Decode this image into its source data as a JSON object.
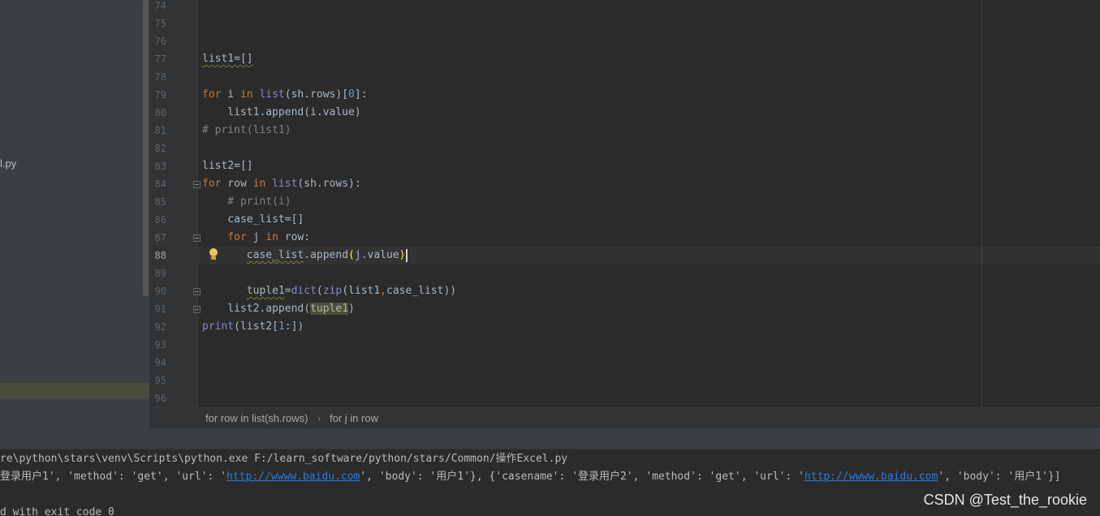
{
  "project": {
    "file_label": "l.py"
  },
  "line_numbers": [
    "74",
    "75",
    "76",
    "77",
    "78",
    "79",
    "80",
    "81",
    "82",
    "83",
    "84",
    "85",
    "86",
    "87",
    "88",
    "89",
    "90",
    "91",
    "92",
    "93",
    "94",
    "95",
    "96"
  ],
  "code": {
    "l77": "list1=[]",
    "l79": {
      "kw1": "for",
      "v1": " i ",
      "kw2": "in",
      "sp": " ",
      "fn": "list",
      "a": "(sh.rows)[",
      "n": "0",
      "b": "]:"
    },
    "l80": "    list1.append(i.value)",
    "l81": "# print(list1)",
    "l83": "list2=[]",
    "l84": {
      "kw1": "for",
      "v1": " row ",
      "kw2": "in",
      "sp": " ",
      "fn": "list",
      "a": "(sh.rows):"
    },
    "l85": "    # print(i)",
    "l86": "    case_list=[]",
    "l87": {
      "ind": "    ",
      "kw1": "for",
      "v1": " j ",
      "kw2": "in",
      "a": " row:"
    },
    "l88": {
      "ind": "       ",
      "a": "case_list",
      "b": ".append",
      "p1": "(",
      "c": "j.value",
      "p2": ")"
    },
    "l90": {
      "ind": "       ",
      "a": "tuple1",
      "b": "=",
      "f1": "dict",
      "c": "(",
      "f2": "zip",
      "d": "(list1",
      "e": ",",
      "g": "case_list))"
    },
    "l91": {
      "ind": "    ",
      "a": "list2.append(",
      "b": "tuple1",
      "c": ")"
    },
    "l92": {
      "fn": "print",
      "a": "(list2[",
      "n": "1",
      "b": ":])"
    }
  },
  "breadcrumb": {
    "item1": "for row in list(sh.rows)",
    "separator": "›",
    "item2": "for j in row"
  },
  "console": {
    "cmd": "re\\python\\stars\\venv\\Scripts\\python.exe F:/learn_software/python/stars/Common/操作Excel.py",
    "out_a": "登录用户1', 'method': 'get', 'url': '",
    "link1": "http://wwww.baidu.com",
    "out_b": "', 'body': '用户1'}, {'casename': '登录用户2', 'method': 'get', 'url': '",
    "link2": "http://wwww.baidu.com",
    "out_c": "', 'body': '用户1'}]",
    "exit": "d with exit code 0"
  },
  "watermark": "CSDN @Test_the_rookie",
  "colors": {
    "keyword": "#cc7832",
    "builtin": "#8888c6",
    "number": "#6897bb",
    "comment": "#808080",
    "link": "#287bde"
  }
}
